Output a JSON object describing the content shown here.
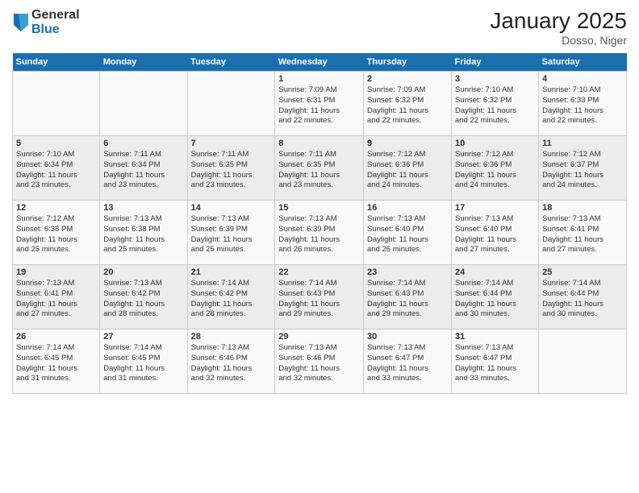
{
  "logo": {
    "general": "General",
    "blue": "Blue"
  },
  "header": {
    "month": "January 2025",
    "location": "Dosso, Niger"
  },
  "days_of_week": [
    "Sunday",
    "Monday",
    "Tuesday",
    "Wednesday",
    "Thursday",
    "Friday",
    "Saturday"
  ],
  "weeks": [
    [
      {
        "day": "",
        "info": ""
      },
      {
        "day": "",
        "info": ""
      },
      {
        "day": "",
        "info": ""
      },
      {
        "day": "1",
        "info": "Sunrise: 7:09 AM\nSunset: 6:31 PM\nDaylight: 11 hours\nand 22 minutes."
      },
      {
        "day": "2",
        "info": "Sunrise: 7:09 AM\nSunset: 6:32 PM\nDaylight: 11 hours\nand 22 minutes."
      },
      {
        "day": "3",
        "info": "Sunrise: 7:10 AM\nSunset: 6:32 PM\nDaylight: 11 hours\nand 22 minutes."
      },
      {
        "day": "4",
        "info": "Sunrise: 7:10 AM\nSunset: 6:33 PM\nDaylight: 11 hours\nand 22 minutes."
      }
    ],
    [
      {
        "day": "5",
        "info": "Sunrise: 7:10 AM\nSunset: 6:34 PM\nDaylight: 11 hours\nand 23 minutes."
      },
      {
        "day": "6",
        "info": "Sunrise: 7:11 AM\nSunset: 6:34 PM\nDaylight: 11 hours\nand 23 minutes."
      },
      {
        "day": "7",
        "info": "Sunrise: 7:11 AM\nSunset: 6:35 PM\nDaylight: 11 hours\nand 23 minutes."
      },
      {
        "day": "8",
        "info": "Sunrise: 7:11 AM\nSunset: 6:35 PM\nDaylight: 11 hours\nand 23 minutes."
      },
      {
        "day": "9",
        "info": "Sunrise: 7:12 AM\nSunset: 6:36 PM\nDaylight: 11 hours\nand 24 minutes."
      },
      {
        "day": "10",
        "info": "Sunrise: 7:12 AM\nSunset: 6:36 PM\nDaylight: 11 hours\nand 24 minutes."
      },
      {
        "day": "11",
        "info": "Sunrise: 7:12 AM\nSunset: 6:37 PM\nDaylight: 11 hours\nand 24 minutes."
      }
    ],
    [
      {
        "day": "12",
        "info": "Sunrise: 7:12 AM\nSunset: 6:38 PM\nDaylight: 11 hours\nand 25 minutes."
      },
      {
        "day": "13",
        "info": "Sunrise: 7:13 AM\nSunset: 6:38 PM\nDaylight: 11 hours\nand 25 minutes."
      },
      {
        "day": "14",
        "info": "Sunrise: 7:13 AM\nSunset: 6:39 PM\nDaylight: 11 hours\nand 25 minutes."
      },
      {
        "day": "15",
        "info": "Sunrise: 7:13 AM\nSunset: 6:39 PM\nDaylight: 11 hours\nand 26 minutes."
      },
      {
        "day": "16",
        "info": "Sunrise: 7:13 AM\nSunset: 6:40 PM\nDaylight: 11 hours\nand 26 minutes."
      },
      {
        "day": "17",
        "info": "Sunrise: 7:13 AM\nSunset: 6:40 PM\nDaylight: 11 hours\nand 27 minutes."
      },
      {
        "day": "18",
        "info": "Sunrise: 7:13 AM\nSunset: 6:41 PM\nDaylight: 11 hours\nand 27 minutes."
      }
    ],
    [
      {
        "day": "19",
        "info": "Sunrise: 7:13 AM\nSunset: 6:41 PM\nDaylight: 11 hours\nand 27 minutes."
      },
      {
        "day": "20",
        "info": "Sunrise: 7:13 AM\nSunset: 6:42 PM\nDaylight: 11 hours\nand 28 minutes."
      },
      {
        "day": "21",
        "info": "Sunrise: 7:14 AM\nSunset: 6:42 PM\nDaylight: 11 hours\nand 28 minutes."
      },
      {
        "day": "22",
        "info": "Sunrise: 7:14 AM\nSunset: 6:43 PM\nDaylight: 11 hours\nand 29 minutes."
      },
      {
        "day": "23",
        "info": "Sunrise: 7:14 AM\nSunset: 6:43 PM\nDaylight: 11 hours\nand 29 minutes."
      },
      {
        "day": "24",
        "info": "Sunrise: 7:14 AM\nSunset: 6:44 PM\nDaylight: 11 hours\nand 30 minutes."
      },
      {
        "day": "25",
        "info": "Sunrise: 7:14 AM\nSunset: 6:44 PM\nDaylight: 11 hours\nand 30 minutes."
      }
    ],
    [
      {
        "day": "26",
        "info": "Sunrise: 7:14 AM\nSunset: 6:45 PM\nDaylight: 11 hours\nand 31 minutes."
      },
      {
        "day": "27",
        "info": "Sunrise: 7:14 AM\nSunset: 6:45 PM\nDaylight: 11 hours\nand 31 minutes."
      },
      {
        "day": "28",
        "info": "Sunrise: 7:13 AM\nSunset: 6:46 PM\nDaylight: 11 hours\nand 32 minutes."
      },
      {
        "day": "29",
        "info": "Sunrise: 7:13 AM\nSunset: 6:46 PM\nDaylight: 11 hours\nand 32 minutes."
      },
      {
        "day": "30",
        "info": "Sunrise: 7:13 AM\nSunset: 6:47 PM\nDaylight: 11 hours\nand 33 minutes."
      },
      {
        "day": "31",
        "info": "Sunrise: 7:13 AM\nSunset: 6:47 PM\nDaylight: 11 hours\nand 33 minutes."
      },
      {
        "day": "",
        "info": ""
      }
    ]
  ]
}
